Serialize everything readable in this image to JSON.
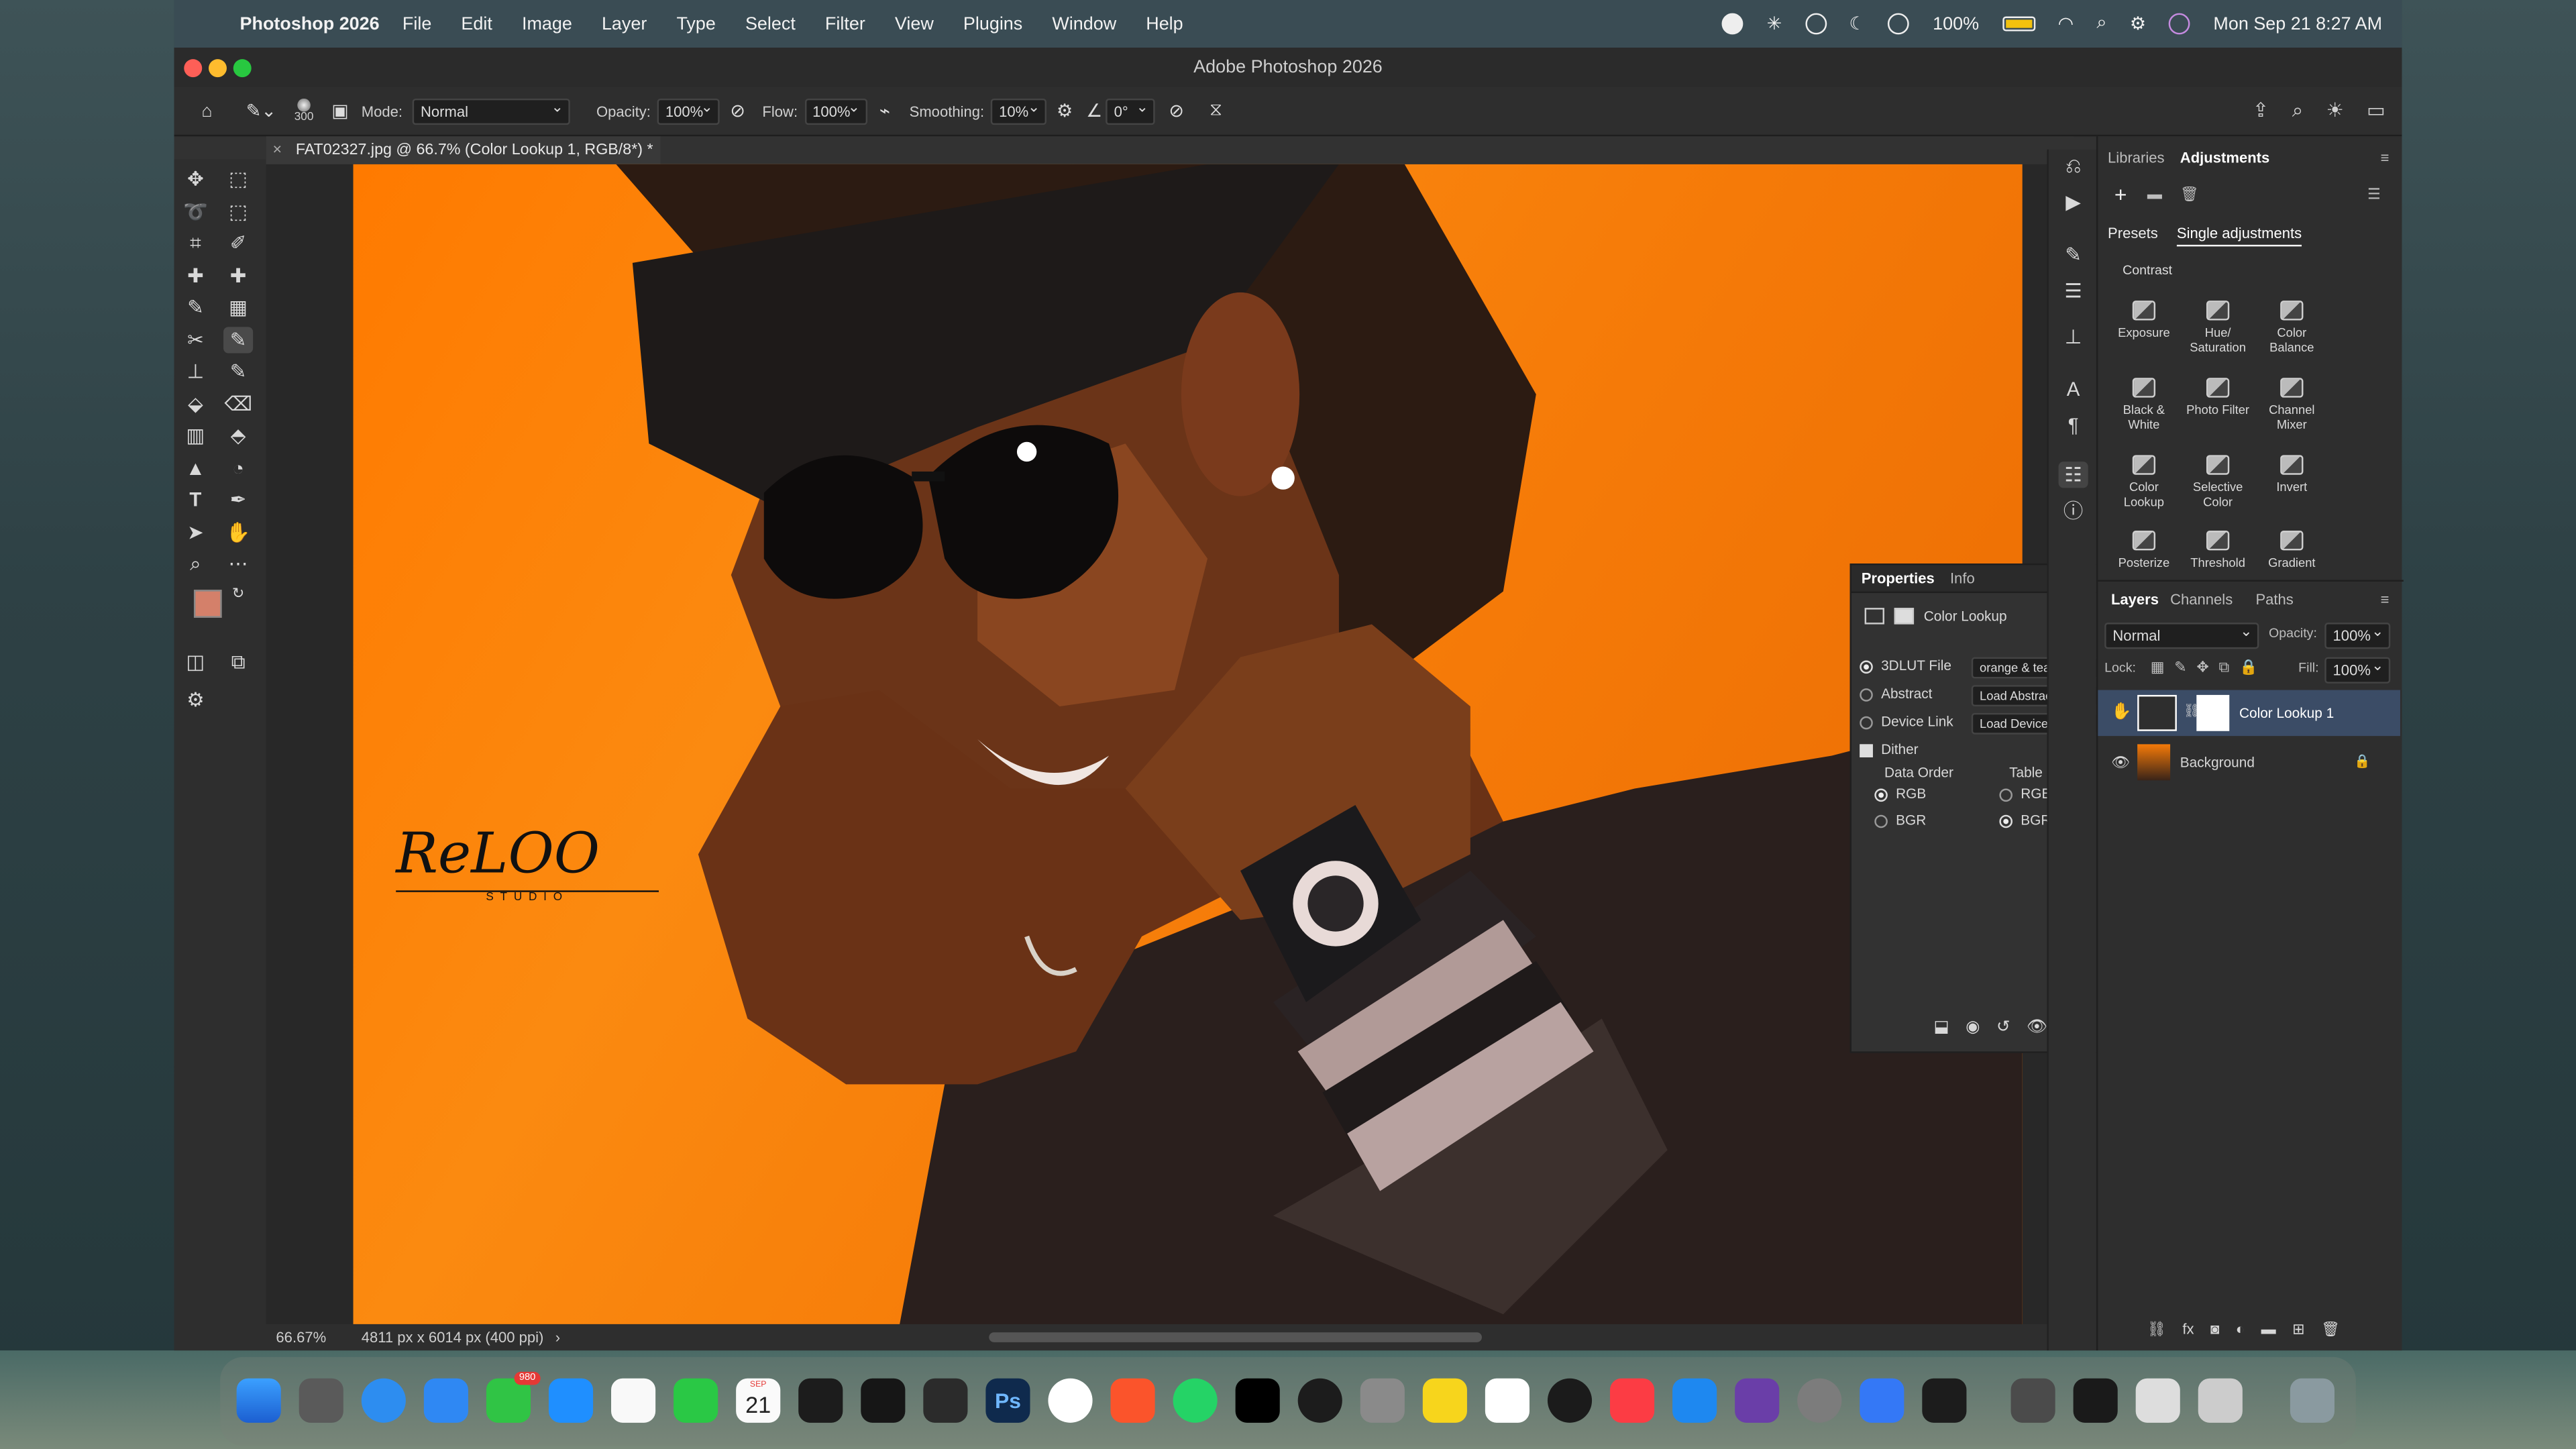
{
  "menubar": {
    "app_name": "Photoshop 2026",
    "items": [
      "File",
      "Edit",
      "Image",
      "Layer",
      "Type",
      "Select",
      "Filter",
      "View",
      "Plugins",
      "Window",
      "Help"
    ],
    "battery": "100%",
    "clock": "Mon Sep 21  8:27 AM"
  },
  "window": {
    "title": "Adobe Photoshop 2026"
  },
  "options": {
    "brush_size": "300",
    "mode_label": "Mode:",
    "mode_value": "Normal",
    "opacity_label": "Opacity:",
    "opacity_value": "100%",
    "flow_label": "Flow:",
    "flow_value": "100%",
    "smoothing_label": "Smoothing:",
    "smoothing_value": "10%",
    "angle_value": "0°"
  },
  "document": {
    "tab_title": "FAT02327.jpg @ 66.7% (Color Lookup 1, RGB/8*) *",
    "zoom": "66.67%",
    "info": "4811 px x 6014 px (400 ppi)",
    "watermark_text": "ReLOO",
    "watermark_sub": "STUDIO"
  },
  "adjustments_panel": {
    "tabs": [
      "Libraries",
      "Adjustments"
    ],
    "subtabs": [
      "Presets",
      "Single adjustments"
    ],
    "section": "Contrast",
    "items": [
      {
        "label": "Exposure",
        "icon": "exposure-icon"
      },
      {
        "label": "Hue/ Saturation",
        "icon": "hue-saturation-icon"
      },
      {
        "label": "Color Balance",
        "icon": "color-balance-icon"
      },
      {
        "label": "Black & White",
        "icon": "black-white-icon"
      },
      {
        "label": "Photo Filter",
        "icon": "photo-filter-icon"
      },
      {
        "label": "Channel Mixer",
        "icon": "channel-mixer-icon"
      },
      {
        "label": "Color Lookup",
        "icon": "color-lookup-icon"
      },
      {
        "label": "Selective Color",
        "icon": "selective-color-icon"
      },
      {
        "label": "Invert",
        "icon": "invert-icon"
      },
      {
        "label": "Posterize",
        "icon": "posterize-icon"
      },
      {
        "label": "Threshold",
        "icon": "threshold-icon"
      },
      {
        "label": "Gradient",
        "icon": "gradient-icon"
      }
    ]
  },
  "properties_panel": {
    "tabs": [
      "Properties",
      "Info"
    ],
    "heading": "Color Lookup",
    "rows": [
      {
        "label": "3DLUT File",
        "value": "orange & teal by sl...",
        "selected": true
      },
      {
        "label": "Abstract",
        "value": "Load Abstract Profi...",
        "selected": false
      },
      {
        "label": "Device Link",
        "value": "Load DeviceLink Pr...",
        "selected": false
      }
    ],
    "dither_label": "Dither",
    "data_order_label": "Data Order",
    "table_order_label": "Table Order",
    "data_order_options": [
      "RGB",
      "BGR"
    ],
    "table_order_options": [
      "RGB",
      "BGR"
    ],
    "data_order_selected": "RGB",
    "table_order_selected": "BGR"
  },
  "layers_panel": {
    "tabs": [
      "Layers",
      "Channels",
      "Paths"
    ],
    "blend_mode": "Normal",
    "opacity_label": "Opacity:",
    "opacity_value": "100%",
    "lock_label": "Lock:",
    "fill_label": "Fill:",
    "fill_value": "100%",
    "layers": [
      {
        "name": "Color Lookup 1",
        "selected": true
      },
      {
        "name": "Background",
        "locked": true
      }
    ]
  },
  "colors": {
    "foreground": "#d4806a",
    "background": "#000000",
    "photo_bg": "#f57a08",
    "accent": "#2d6bc8"
  },
  "dock": {
    "messages_badge": "980",
    "calendar_day": "21",
    "calendar_month": "SEP"
  }
}
